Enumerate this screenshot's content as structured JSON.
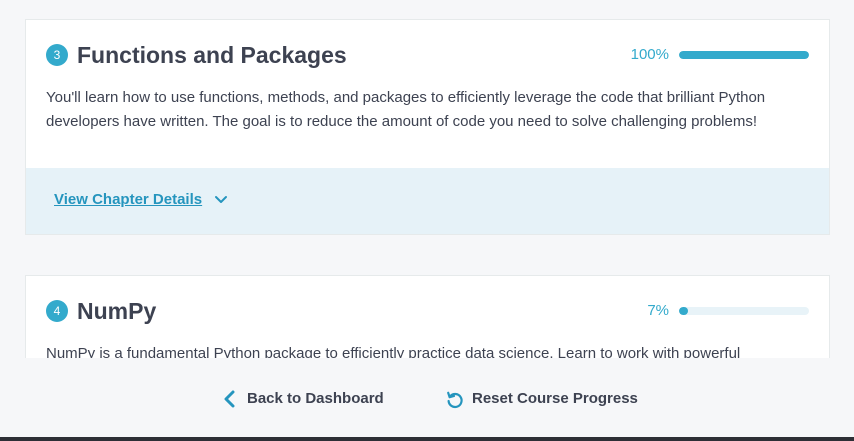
{
  "chapters": [
    {
      "number": "3",
      "title": "Functions and Packages",
      "progress_label": "100%",
      "progress_fraction": 1.0,
      "description": "You'll learn how to use functions, methods, and packages to efficiently leverage the code that brilliant Python developers have written. The goal is to reduce the amount of code you need to solve challenging problems!",
      "details_link": "View Chapter Details"
    },
    {
      "number": "4",
      "title": "NumPy",
      "progress_label": "7%",
      "progress_fraction": 0.07,
      "description": "NumPy is a fundamental Python package to efficiently practice data science. Learn to work with powerful"
    }
  ],
  "footer": {
    "back_label": "Back to Dashboard",
    "reset_label": "Reset Course Progress"
  },
  "colors": {
    "accent": "#33aacc",
    "link": "#2595be",
    "track": "#e8f3f8",
    "details_bg": "#e6f2f8"
  },
  "icons": {
    "details_toggle": "chevron-down-icon",
    "back": "chevron-left-icon",
    "reset": "reset-icon"
  }
}
